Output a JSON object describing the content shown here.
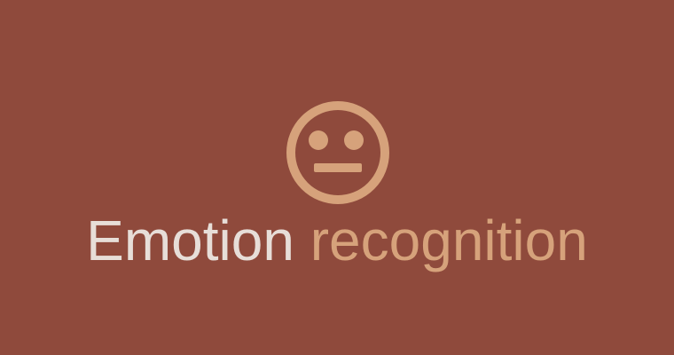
{
  "colors": {
    "background": "#8f4a3c",
    "accent": "#d6a27b",
    "light_text": "#e7ded8"
  },
  "icon": {
    "name": "neutral-face-icon"
  },
  "headline": {
    "word_1": "Emotion",
    "word_2": "recognition"
  }
}
